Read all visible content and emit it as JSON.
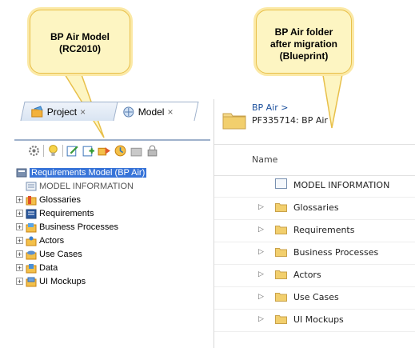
{
  "callouts": {
    "left": {
      "line1": "BP Air Model",
      "line2": "(RC2010)"
    },
    "right": {
      "line1": "BP Air folder",
      "line2": "after migration",
      "line3": "(Blueprint)"
    }
  },
  "left_panel": {
    "tabs": [
      {
        "label": "Project",
        "close": "×"
      },
      {
        "label": "Model",
        "close": "×"
      }
    ],
    "tree": {
      "root": "Requirements Model (BP Air)",
      "items": [
        {
          "label": "MODEL INFORMATION",
          "expander": ""
        },
        {
          "label": "Glossaries",
          "expander": "+"
        },
        {
          "label": "Requirements",
          "expander": "+"
        },
        {
          "label": "Business Processes",
          "expander": "+"
        },
        {
          "label": "Actors",
          "expander": "+"
        },
        {
          "label": "Use Cases",
          "expander": "+"
        },
        {
          "label": "Data",
          "expander": "+"
        },
        {
          "label": "UI Mockups",
          "expander": "+"
        }
      ]
    }
  },
  "right_panel": {
    "breadcrumb": "BP Air >",
    "folder_title": "PF335714: BP Air",
    "column_name": "Name",
    "rows": [
      {
        "label": "MODEL INFORMATION",
        "expander": ""
      },
      {
        "label": "Glossaries",
        "expander": "▷"
      },
      {
        "label": "Requirements",
        "expander": "▷"
      },
      {
        "label": "Business Processes",
        "expander": "▷"
      },
      {
        "label": "Actors",
        "expander": "▷"
      },
      {
        "label": "Use Cases",
        "expander": "▷"
      },
      {
        "label": "UI Mockups",
        "expander": "▷"
      }
    ]
  },
  "colors": {
    "callout_fill": "#fdf5c2",
    "callout_border": "#e8c04a",
    "selection": "#3874d8",
    "folder": "#e8c45a"
  }
}
